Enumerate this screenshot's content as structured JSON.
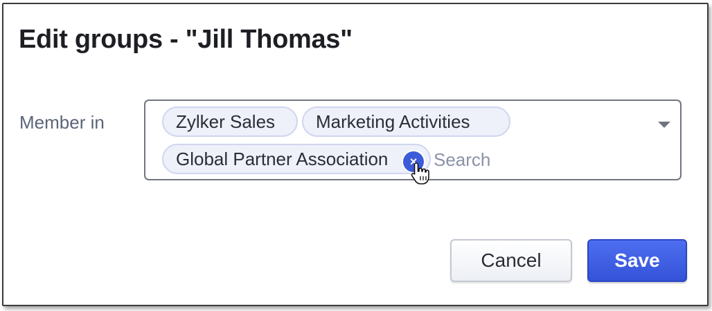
{
  "dialog": {
    "title": "Edit groups - \"Jill Thomas\""
  },
  "field": {
    "label": "Member in",
    "chips": [
      {
        "label": "Zylker Sales"
      },
      {
        "label": "Marketing Activities"
      },
      {
        "label": "Global Partner Association"
      }
    ],
    "remove_icon": "×",
    "search_placeholder": "Search",
    "dropdown_icon": "chevron-down-icon"
  },
  "buttons": {
    "cancel_label": "Cancel",
    "save_label": "Save"
  },
  "colors": {
    "accent": "#3b5bd9",
    "chip_bg": "#eef0fa",
    "label": "#5b6478"
  }
}
